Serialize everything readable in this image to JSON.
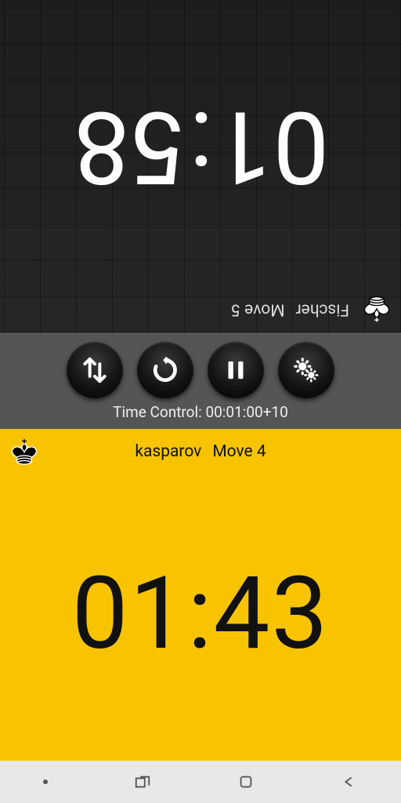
{
  "top": {
    "player": "Fischer",
    "move_label": "Move 5",
    "time": "01:58"
  },
  "bottom": {
    "player": "kasparov",
    "move_label": "Move 4",
    "time": "01:43"
  },
  "controls": {
    "time_control_label": "Time Control: 00:01:00+10",
    "swap_icon": "swap",
    "reset_icon": "reset",
    "pause_icon": "pause",
    "settings_icon": "settings"
  }
}
